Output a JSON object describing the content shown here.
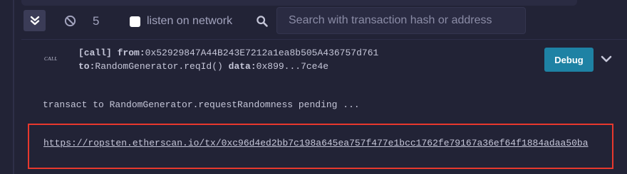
{
  "toolbar": {
    "collapse_icon": "double-chevron-down-icon",
    "clear_icon": "ban-icon",
    "count": "5",
    "listen_label": "listen on network",
    "listen_checked": false,
    "search_icon": "search-icon",
    "search_placeholder": "Search with transaction hash or address",
    "search_value": ""
  },
  "log": {
    "call": {
      "badge": "CALL",
      "tag": "[call]",
      "from_label": "from:",
      "from_value": "0x52929847A44B243E7212a1ea8b505A436757d761",
      "to_label": "to:",
      "to_value": "RandomGenerator.reqId()",
      "data_label": "data:",
      "data_value": "0x899...7ce4e",
      "debug_label": "Debug",
      "expand_icon": "chevron-down-icon"
    },
    "pending_text": "transact to RandomGenerator.requestRandomness pending ...",
    "tx_link": "https://ropsten.etherscan.io/tx/0xc96d4ed2bb7c198a645ea757f477e1bcc1762fe79167a36ef64f1884adaa50ba"
  },
  "colors": {
    "background": "#222336",
    "debug_button": "#1e82a4",
    "highlight_border": "#e8382d"
  }
}
